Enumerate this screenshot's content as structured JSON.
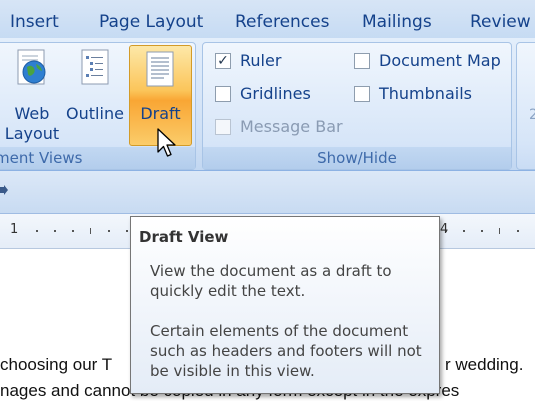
{
  "tabs": [
    {
      "label": "Insert"
    },
    {
      "label": "Page Layout"
    },
    {
      "label": "References"
    },
    {
      "label": "Mailings"
    },
    {
      "label": "Review"
    }
  ],
  "views_group": {
    "label": "ment Views",
    "web_layout": [
      "Web",
      "Layout"
    ],
    "outline": "Outline",
    "draft": "Draft"
  },
  "showhide_group": {
    "label": "Show/Hide",
    "ruler": {
      "label": "Ruler",
      "checked": true
    },
    "gridlines": {
      "label": "Gridlines",
      "checked": false
    },
    "message_bar": {
      "label": "Message Bar",
      "checked": false,
      "disabled": true
    },
    "document_map": {
      "label": "Document Map",
      "checked": false
    },
    "thumbnails": {
      "label": "Thumbnails",
      "checked": false
    }
  },
  "ruler": {
    "left_number": "1",
    "right_number": "4"
  },
  "document": {
    "line1_left": "choosing our T",
    "line1_right": "r wedding.",
    "line2": "nages and cannot be copied in any form except in the expres"
  },
  "tooltip": {
    "title": "Draft View",
    "para1": "View the document as a draft to quickly edit the text.",
    "para2": "Certain elements of the document such as headers and footers will not be visible in this view."
  },
  "colors": {
    "ribbon_text": "#15428b",
    "draft_active": "#f9a634"
  }
}
